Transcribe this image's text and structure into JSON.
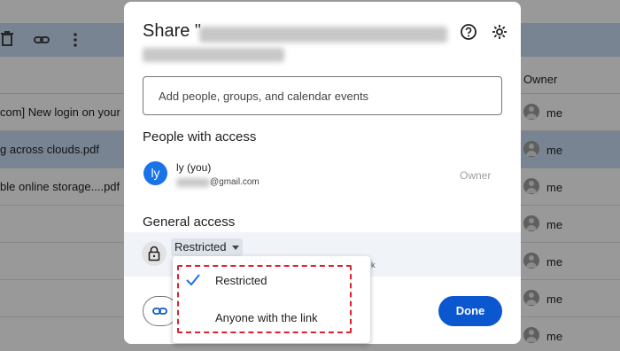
{
  "file_list": {
    "owner_header": "Owner",
    "rows": [
      {
        "name": "com] New login on your p",
        "owner": "me",
        "selected": false
      },
      {
        "name": "g across clouds.pdf",
        "owner": "me",
        "selected": true
      },
      {
        "name": "ble online storage....pdf",
        "owner": "me",
        "selected": false
      },
      {
        "name": "",
        "owner": "me",
        "selected": false
      },
      {
        "name": "",
        "owner": "me",
        "selected": false
      },
      {
        "name": "",
        "owner": "me",
        "selected": false
      },
      {
        "name": "",
        "owner": "me",
        "selected": false
      }
    ]
  },
  "dialog": {
    "title_prefix": "Share \"",
    "add_placeholder": "Add people, groups, and calendar events",
    "people_heading": "People with access",
    "person": {
      "initials": "ly",
      "name": "ly   (you)",
      "email": "@gmail.com",
      "role": "Owner"
    },
    "general_heading": "General access",
    "access_level": "Restricted",
    "peek_text": "k",
    "done_label": "Done",
    "dropdown": {
      "items": [
        {
          "label": "Restricted",
          "checked": true
        },
        {
          "label": "Anyone with the link",
          "checked": false
        }
      ]
    }
  },
  "icons": {
    "toolbar": [
      "trash-icon",
      "link-icon",
      "more-vert-icon"
    ],
    "header": [
      "help-icon",
      "settings-icon"
    ],
    "lock": "lock-icon",
    "copy_link": "link-icon",
    "check": "check-icon"
  },
  "colors": {
    "accent": "#0b57d0",
    "check": "#1a73e8",
    "highlight": "#e0202e",
    "selected_row": "#c9dcf3"
  }
}
